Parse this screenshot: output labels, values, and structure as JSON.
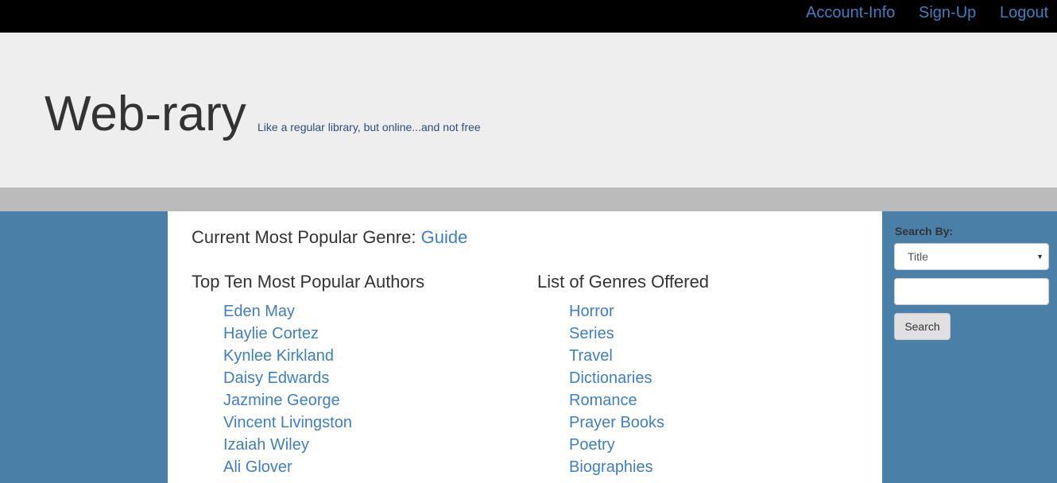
{
  "nav": {
    "account": "Account-Info",
    "signup": "Sign-Up",
    "logout": "Logout"
  },
  "header": {
    "title": "Web-rary",
    "tagline": "Like a regular library, but online...and not free"
  },
  "main": {
    "popular_genre_label": "Current Most Popular Genre:",
    "popular_genre": "Guide",
    "authors_heading": "Top Ten Most Popular Authors",
    "authors": [
      "Eden May",
      "Haylie Cortez",
      "Kynlee Kirkland",
      "Daisy Edwards",
      "Jazmine George",
      "Vincent Livingston",
      "Izaiah Wiley",
      "Ali Glover"
    ],
    "genres_heading": "List of Genres Offered",
    "genres": [
      "Horror",
      "Series",
      "Travel",
      "Dictionaries",
      "Romance",
      "Prayer Books",
      "Poetry",
      "Biographies"
    ]
  },
  "sidebar": {
    "search_by_label": "Search By:",
    "search_by_selected": "Title",
    "search_input_value": "",
    "search_button": "Search"
  },
  "colors": {
    "nav_bg": "#000000",
    "link": "#3f7fc0",
    "hero_bg": "#eeeeee",
    "divider_bar": "#bbbbbb",
    "page_bg": "#4a7fa8",
    "content_bg": "#ffffff"
  }
}
